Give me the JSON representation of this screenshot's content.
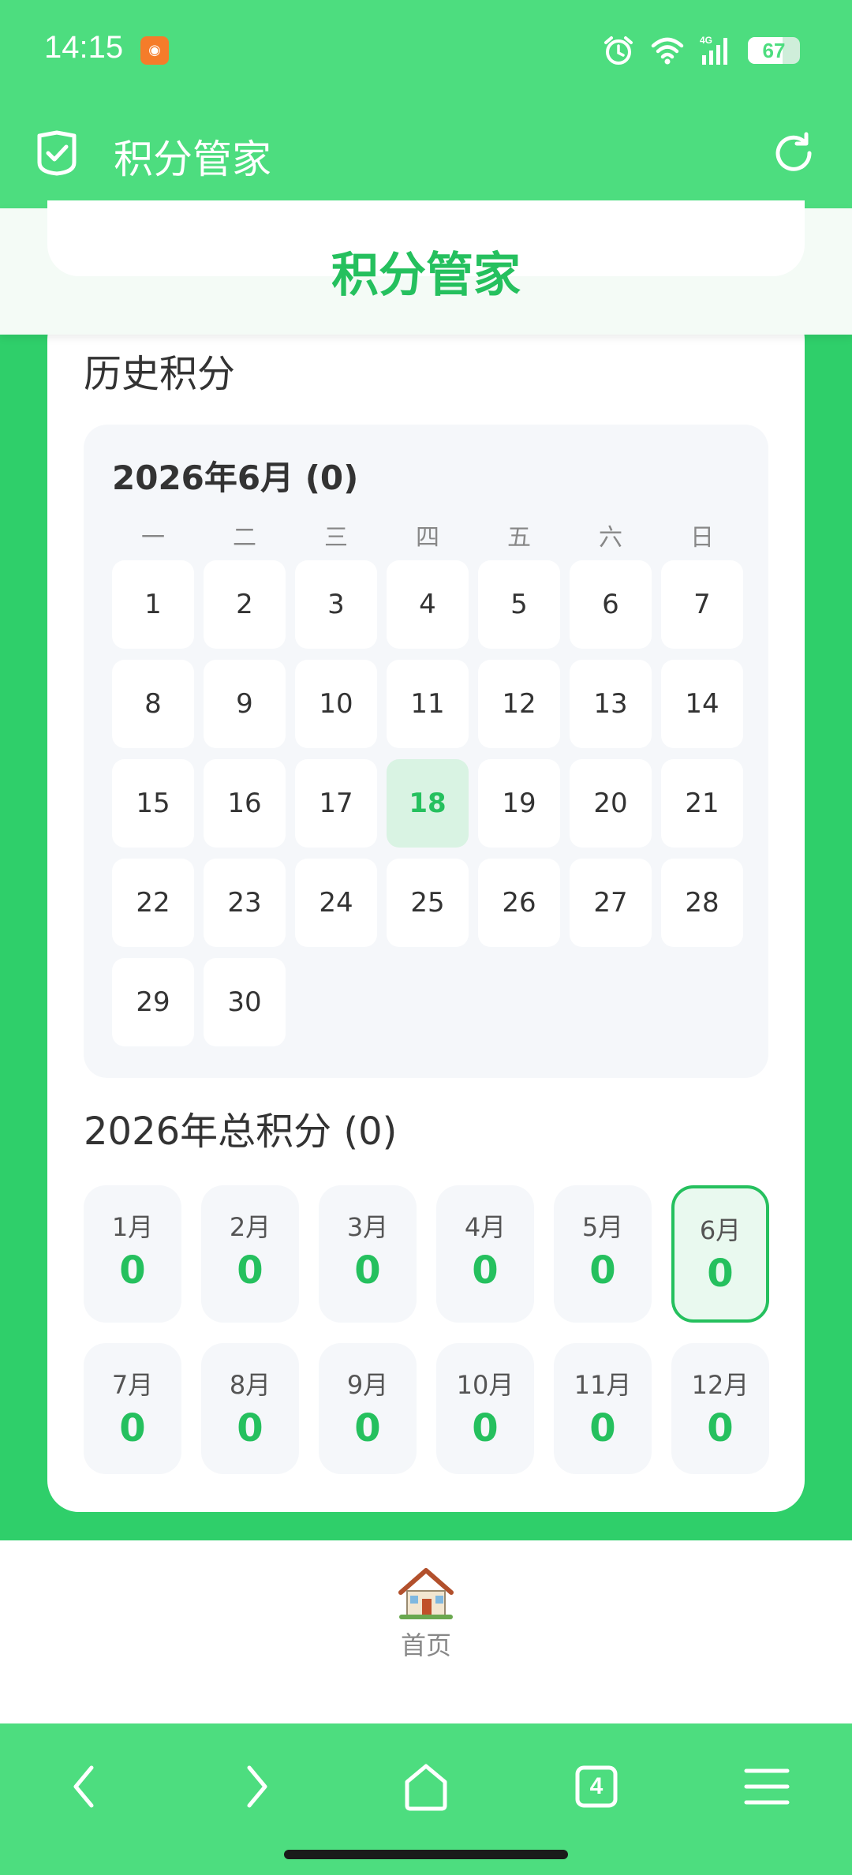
{
  "status_bar": {
    "time": "14:15",
    "battery": "67",
    "battery_level": 0.67,
    "network": "4G"
  },
  "app_bar": {
    "title": "积分管家"
  },
  "header": {
    "title": "积分管家"
  },
  "history": {
    "title": "历史积分",
    "calendar_title": "2026年6月 (0)",
    "weekdays": [
      "一",
      "二",
      "三",
      "四",
      "五",
      "六",
      "日"
    ],
    "days": [
      "1",
      "2",
      "3",
      "4",
      "5",
      "6",
      "7",
      "8",
      "9",
      "10",
      "11",
      "12",
      "13",
      "14",
      "15",
      "16",
      "17",
      "18",
      "19",
      "20",
      "21",
      "22",
      "23",
      "24",
      "25",
      "26",
      "27",
      "28",
      "29",
      "30"
    ],
    "today": "18"
  },
  "year_total": {
    "title": "2026年总积分 (0)",
    "months": [
      {
        "label": "1月",
        "value": "0"
      },
      {
        "label": "2月",
        "value": "0"
      },
      {
        "label": "3月",
        "value": "0"
      },
      {
        "label": "4月",
        "value": "0"
      },
      {
        "label": "5月",
        "value": "0"
      },
      {
        "label": "6月",
        "value": "0"
      },
      {
        "label": "7月",
        "value": "0"
      },
      {
        "label": "8月",
        "value": "0"
      },
      {
        "label": "9月",
        "value": "0"
      },
      {
        "label": "10月",
        "value": "0"
      },
      {
        "label": "11月",
        "value": "0"
      },
      {
        "label": "12月",
        "value": "0"
      }
    ],
    "selected_month": "6月"
  },
  "tabbar": {
    "home_label": "首页"
  },
  "browser_nav": {
    "tab_count": "4"
  },
  "colors": {
    "primary": "#4ddd7f",
    "accent": "#25c05e",
    "background": "#2fcf6a"
  }
}
